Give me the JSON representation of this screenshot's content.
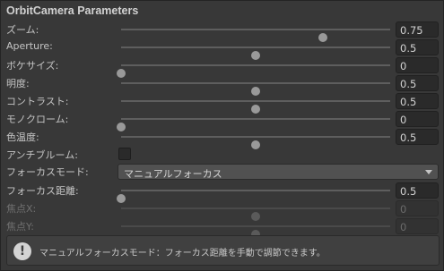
{
  "panel": {
    "title": "OrbitCamera Parameters"
  },
  "sliders": [
    {
      "label": "ズーム:",
      "value": "0.75",
      "fraction": 0.75,
      "disabled": false
    },
    {
      "label": "Aperture:",
      "value": "0.5",
      "fraction": 0.5,
      "disabled": false
    },
    {
      "label": "ボケサイズ:",
      "value": "0",
      "fraction": 0,
      "disabled": false
    },
    {
      "label": "明度:",
      "value": "0.5",
      "fraction": 0.5,
      "disabled": false
    },
    {
      "label": "コントラスト:",
      "value": "0.5",
      "fraction": 0.5,
      "disabled": false
    },
    {
      "label": "モノクローム:",
      "value": "0",
      "fraction": 0,
      "disabled": false
    },
    {
      "label": "色温度:",
      "value": "0.5",
      "fraction": 0.5,
      "disabled": false
    }
  ],
  "antibloom": {
    "label": "アンチブルーム:",
    "checked": false
  },
  "focus_mode": {
    "label": "フォーカスモード:",
    "selected": "マニュアルフォーカス"
  },
  "focus_sliders": [
    {
      "label": "フォーカス距離:",
      "value": "0.5",
      "fraction": 0,
      "disabled": false
    },
    {
      "label": "焦点X:",
      "value": "0",
      "fraction": 0.5,
      "disabled": true
    },
    {
      "label": "焦点Y:",
      "value": "0",
      "fraction": 0.5,
      "disabled": true
    }
  ],
  "help": {
    "icon": "info-icon",
    "text": "マニュアルフォーカスモード：フォーカス距離を手動で調節できます。"
  }
}
